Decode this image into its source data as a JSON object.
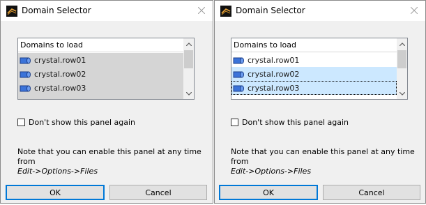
{
  "dialogs": [
    {
      "title": "Domain Selector",
      "list_header": "Domains to load",
      "items": [
        {
          "label": "crystal.row01",
          "state": "gray"
        },
        {
          "label": "crystal.row02",
          "state": "gray"
        },
        {
          "label": "crystal.row03",
          "state": "gray"
        }
      ],
      "checkbox_label": "Don't show this panel again",
      "checkbox_checked": false,
      "note_line1": "Note that you can enable this panel at any time from",
      "note_line2": "Edit->Options->Files",
      "ok_label": "OK",
      "cancel_label": "Cancel"
    },
    {
      "title": "Domain Selector",
      "list_header": "Domains to load",
      "items": [
        {
          "label": "crystal.row01",
          "state": "normal"
        },
        {
          "label": "crystal.row02",
          "state": "selected"
        },
        {
          "label": "crystal.row03",
          "state": "selected-focused"
        }
      ],
      "checkbox_label": "Don't show this panel again",
      "checkbox_checked": false,
      "note_line1": "Note that you can enable this panel at any time from",
      "note_line2": "Edit->Options->Files",
      "ok_label": "OK",
      "cancel_label": "Cancel"
    }
  ],
  "icons": {
    "app": "app-logo-icon",
    "close": "close-icon",
    "domain": "cylinder-icon",
    "scroll_up": "chevron-up-icon",
    "scroll_down": "chevron-down-icon"
  },
  "colors": {
    "dialog_bg": "#f0f0f0",
    "selection": "#cce8ff",
    "inactive_selection": "#d5d5d5",
    "default_button_border": "#0078d7",
    "domain_icon": "#3b73d9"
  }
}
